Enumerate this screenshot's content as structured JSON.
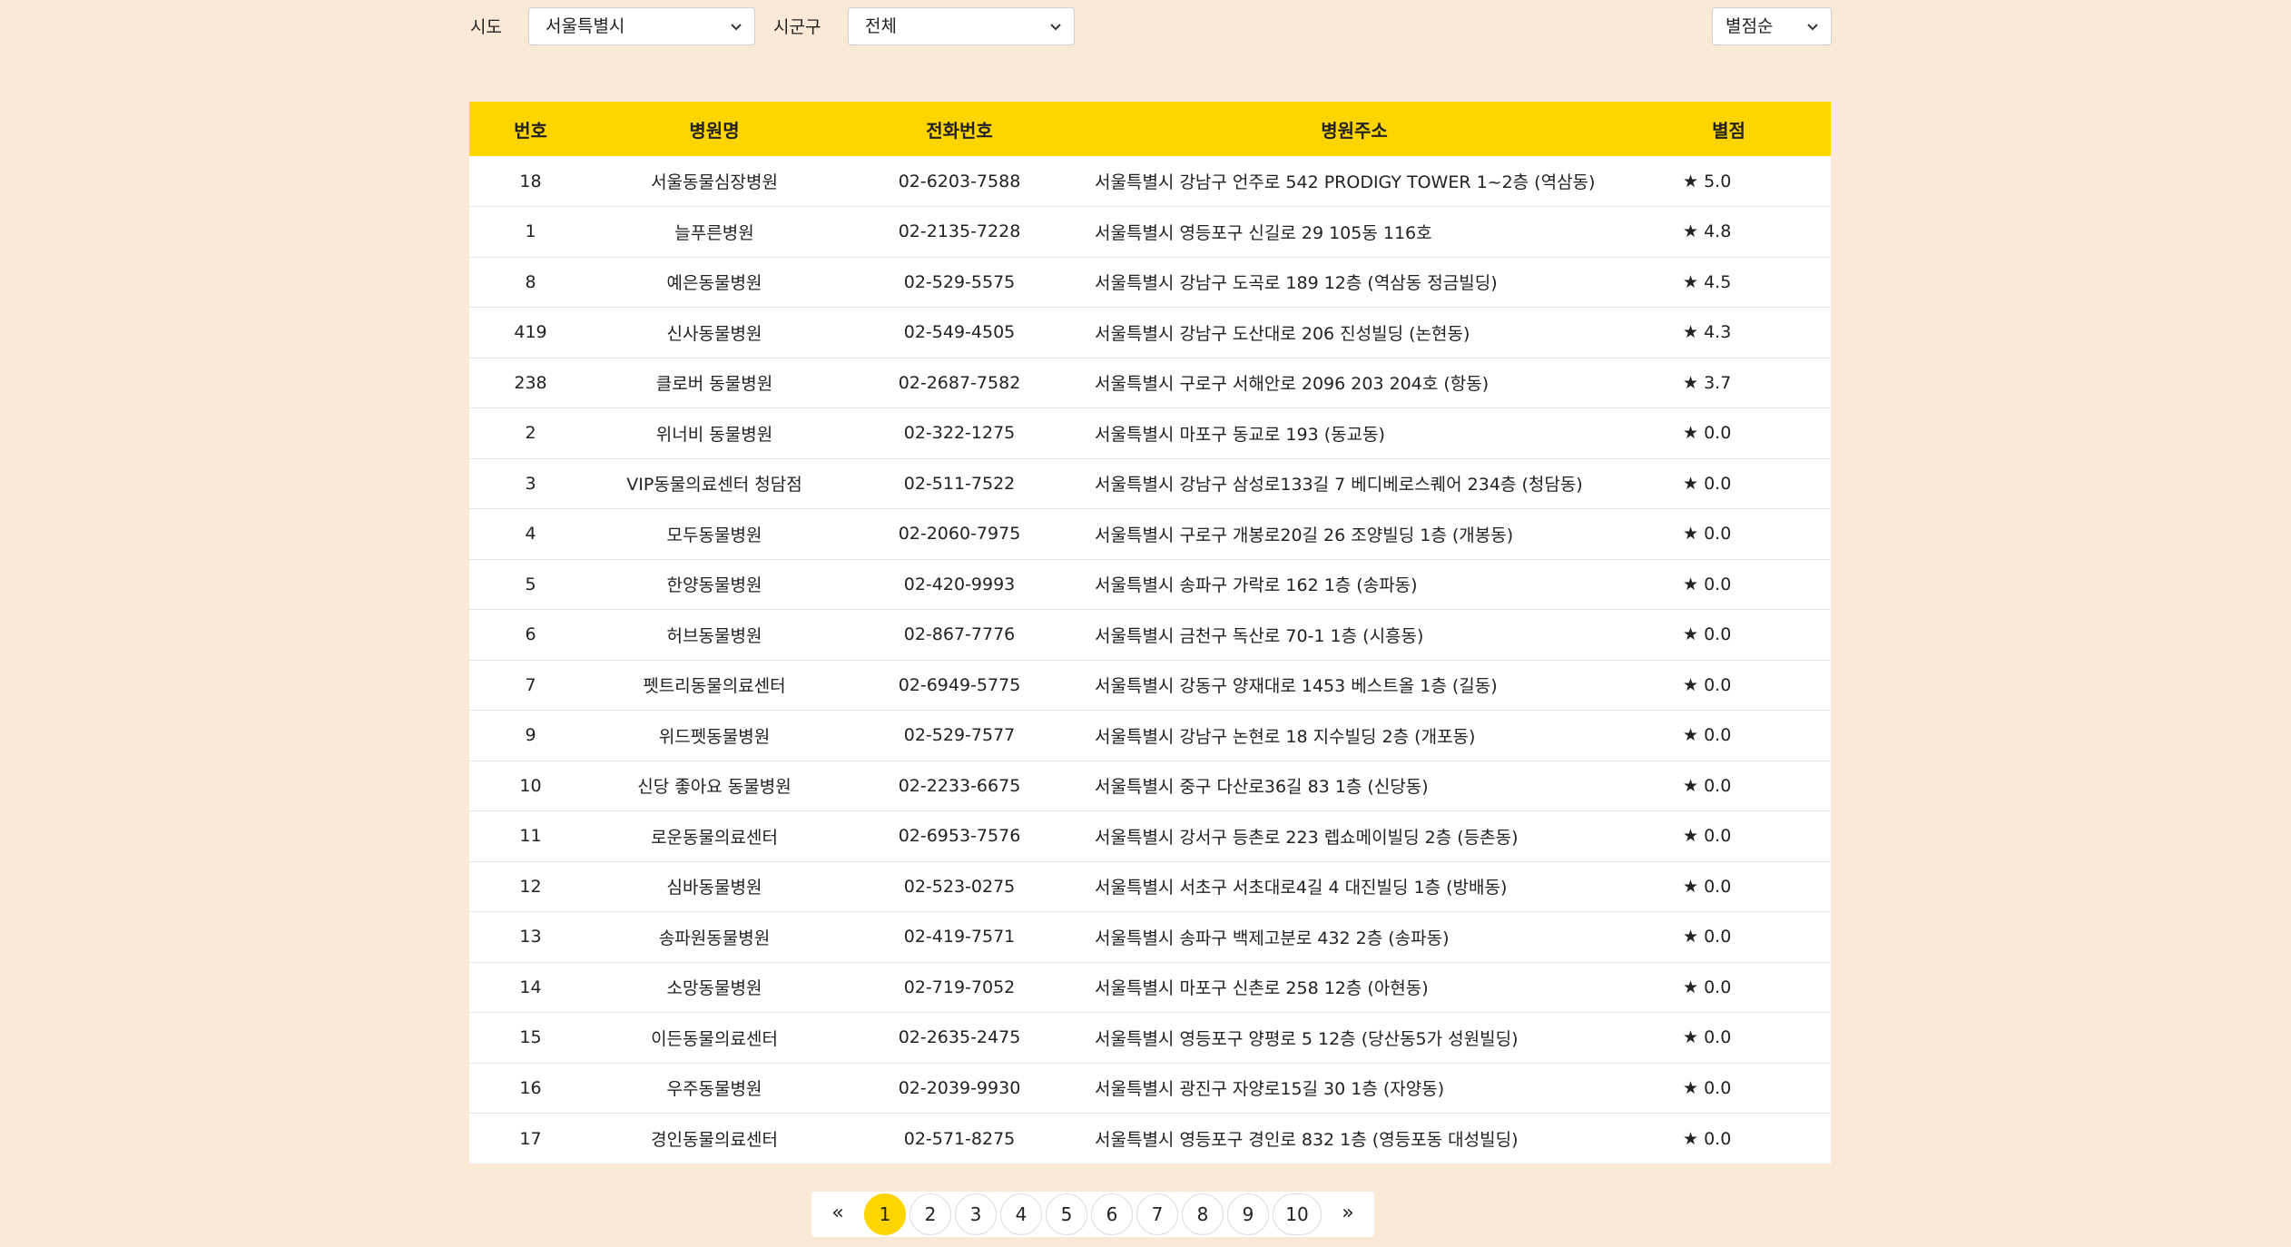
{
  "filters": {
    "sido_label": "시도",
    "sido_value": "서울특별시",
    "sigungu_label": "시군구",
    "sigungu_value": "전체",
    "sort_value": "별점순"
  },
  "table": {
    "headers": [
      "번호",
      "병원명",
      "전화번호",
      "병원주소",
      "별점"
    ],
    "rows": [
      {
        "no": "18",
        "name": "서울동물심장병원",
        "phone": "02-6203-7588",
        "address": "서울특별시 강남구 언주로 542 PRODIGY TOWER 1~2층 (역삼동)",
        "rating": "★ 5.0"
      },
      {
        "no": "1",
        "name": "늘푸른병원",
        "phone": "02-2135-7228",
        "address": "서울특별시 영등포구 신길로 29 105동 116호",
        "rating": "★ 4.8"
      },
      {
        "no": "8",
        "name": "예은동물병원",
        "phone": "02-529-5575",
        "address": "서울특별시 강남구 도곡로 189 12층 (역삼동 정금빌딩)",
        "rating": "★ 4.5"
      },
      {
        "no": "419",
        "name": "신사동물병원",
        "phone": "02-549-4505",
        "address": "서울특별시 강남구 도산대로 206 진성빌딩 (논현동)",
        "rating": "★ 4.3"
      },
      {
        "no": "238",
        "name": "클로버 동물병원",
        "phone": "02-2687-7582",
        "address": "서울특별시 구로구 서해안로 2096 203 204호 (항동)",
        "rating": "★ 3.7"
      },
      {
        "no": "2",
        "name": "위너비 동물병원",
        "phone": "02-322-1275",
        "address": "서울특별시 마포구 동교로 193 (동교동)",
        "rating": "★ 0.0"
      },
      {
        "no": "3",
        "name": "VIP동물의료센터 청담점",
        "phone": "02-511-7522",
        "address": "서울특별시 강남구 삼성로133길 7 베디베로스퀘어 234층 (청담동)",
        "rating": "★ 0.0"
      },
      {
        "no": "4",
        "name": "모두동물병원",
        "phone": "02-2060-7975",
        "address": "서울특별시 구로구 개봉로20길 26 조양빌딩 1층 (개봉동)",
        "rating": "★ 0.0"
      },
      {
        "no": "5",
        "name": "한양동물병원",
        "phone": "02-420-9993",
        "address": "서울특별시 송파구 가락로 162 1층 (송파동)",
        "rating": "★ 0.0"
      },
      {
        "no": "6",
        "name": "허브동물병원",
        "phone": "02-867-7776",
        "address": "서울특별시 금천구 독산로 70-1 1층 (시흥동)",
        "rating": "★ 0.0"
      },
      {
        "no": "7",
        "name": "펫트리동물의료센터",
        "phone": "02-6949-5775",
        "address": "서울특별시 강동구 양재대로 1453 베스트올 1층 (길동)",
        "rating": "★ 0.0"
      },
      {
        "no": "9",
        "name": "위드펫동물병원",
        "phone": "02-529-7577",
        "address": "서울특별시 강남구 논현로 18 지수빌딩 2층 (개포동)",
        "rating": "★ 0.0"
      },
      {
        "no": "10",
        "name": "신당 좋아요 동물병원",
        "phone": "02-2233-6675",
        "address": "서울특별시 중구 다산로36길 83 1층 (신당동)",
        "rating": "★ 0.0"
      },
      {
        "no": "11",
        "name": "로운동물의료센터",
        "phone": "02-6953-7576",
        "address": "서울특별시 강서구 등촌로 223 렙쇼메이빌딩 2층 (등촌동)",
        "rating": "★ 0.0"
      },
      {
        "no": "12",
        "name": "심바동물병원",
        "phone": "02-523-0275",
        "address": "서울특별시 서초구 서초대로4길 4 대진빌딩 1층 (방배동)",
        "rating": "★ 0.0"
      },
      {
        "no": "13",
        "name": "송파원동물병원",
        "phone": "02-419-7571",
        "address": "서울특별시 송파구 백제고분로 432 2층 (송파동)",
        "rating": "★ 0.0"
      },
      {
        "no": "14",
        "name": "소망동물병원",
        "phone": "02-719-7052",
        "address": "서울특별시 마포구 신촌로 258 12층 (아현동)",
        "rating": "★ 0.0"
      },
      {
        "no": "15",
        "name": "이든동물의료센터",
        "phone": "02-2635-2475",
        "address": "서울특별시 영등포구 양평로 5 12층 (당산동5가 성원빌딩)",
        "rating": "★ 0.0"
      },
      {
        "no": "16",
        "name": "우주동물병원",
        "phone": "02-2039-9930",
        "address": "서울특별시 광진구 자양로15길 30 1층 (자양동)",
        "rating": "★ 0.0"
      },
      {
        "no": "17",
        "name": "경인동물의료센터",
        "phone": "02-571-8275",
        "address": "서울특별시 영등포구 경인로 832 1층 (영등포동 대성빌딩)",
        "rating": "★ 0.0"
      }
    ]
  },
  "pagination": {
    "first": "«",
    "pages": [
      "1",
      "2",
      "3",
      "4",
      "5",
      "6",
      "7",
      "8",
      "9",
      "10"
    ],
    "current": "1",
    "last": "»"
  },
  "colors": {
    "background": "#fae9d6",
    "accent": "#ffd500"
  }
}
